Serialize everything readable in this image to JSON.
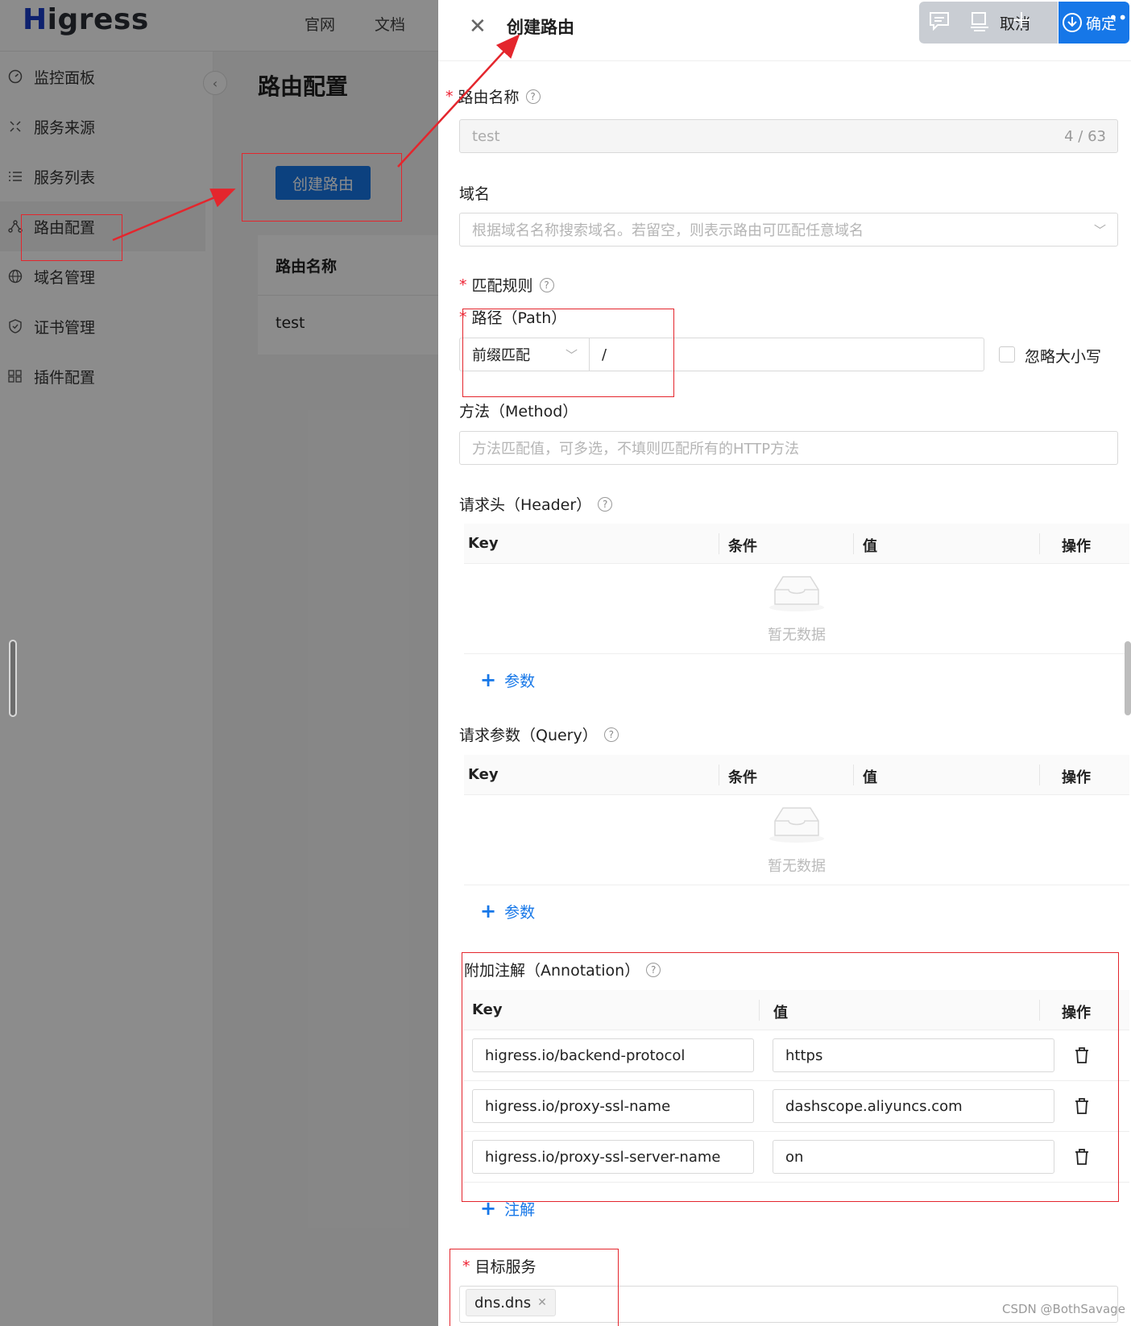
{
  "app": {
    "logo": {
      "first": "H",
      "rest": "igress"
    },
    "top_links": [
      "官网",
      "文档"
    ],
    "sidebar": [
      {
        "label": "监控面板",
        "icon": "dashboard-icon"
      },
      {
        "label": "服务来源",
        "icon": "source-icon"
      },
      {
        "label": "服务列表",
        "icon": "list-icon"
      },
      {
        "label": "路由配置",
        "icon": "route-icon",
        "active": true
      },
      {
        "label": "域名管理",
        "icon": "globe-icon"
      },
      {
        "label": "证书管理",
        "icon": "shield-icon"
      },
      {
        "label": "插件配置",
        "icon": "plugin-icon"
      }
    ],
    "page_title": "路由配置",
    "create_button": "创建路由",
    "table": {
      "header": "路由名称",
      "rows": [
        "test"
      ]
    }
  },
  "drawer": {
    "title": "创建路由",
    "cancel_label": "取消",
    "ok_label": "确定",
    "route_name": {
      "label": "路由名称",
      "value": "test",
      "count": "4 / 63"
    },
    "domain": {
      "label": "域名",
      "placeholder": "根据域名名称搜索域名。若留空，则表示路由可匹配任意域名"
    },
    "match_rules": {
      "label": "匹配规则"
    },
    "path": {
      "label": "路径（Path）",
      "match_type": "前缀匹配",
      "value": "/",
      "ignore_case_label": "忽略大小写"
    },
    "method": {
      "label": "方法（Method）",
      "placeholder": "方法匹配值，可多选，不填则匹配所有的HTTP方法"
    },
    "header": {
      "label": "请求头（Header）",
      "columns": [
        "Key",
        "条件",
        "值",
        "操作"
      ],
      "empty_text": "暂无数据",
      "add_label": "参数"
    },
    "query": {
      "label": "请求参数（Query）",
      "columns": [
        "Key",
        "条件",
        "值",
        "操作"
      ],
      "empty_text": "暂无数据",
      "add_label": "参数"
    },
    "annotation": {
      "label": "附加注解（Annotation）",
      "columns": [
        "Key",
        "值",
        "操作"
      ],
      "rows": [
        {
          "key": "higress.io/backend-protocol",
          "value": "https"
        },
        {
          "key": "higress.io/proxy-ssl-name",
          "value": "dashscope.aliyuncs.com"
        },
        {
          "key": "higress.io/proxy-ssl-server-name",
          "value": "on"
        }
      ],
      "add_label": "注解"
    },
    "target_service": {
      "label": "目标服务",
      "tag": "dns.dns"
    }
  },
  "watermark": "CSDN @BothSavage",
  "colors": {
    "primary": "#1677e8",
    "annotation_red": "#e4262d",
    "required_star": "#ee2233"
  }
}
